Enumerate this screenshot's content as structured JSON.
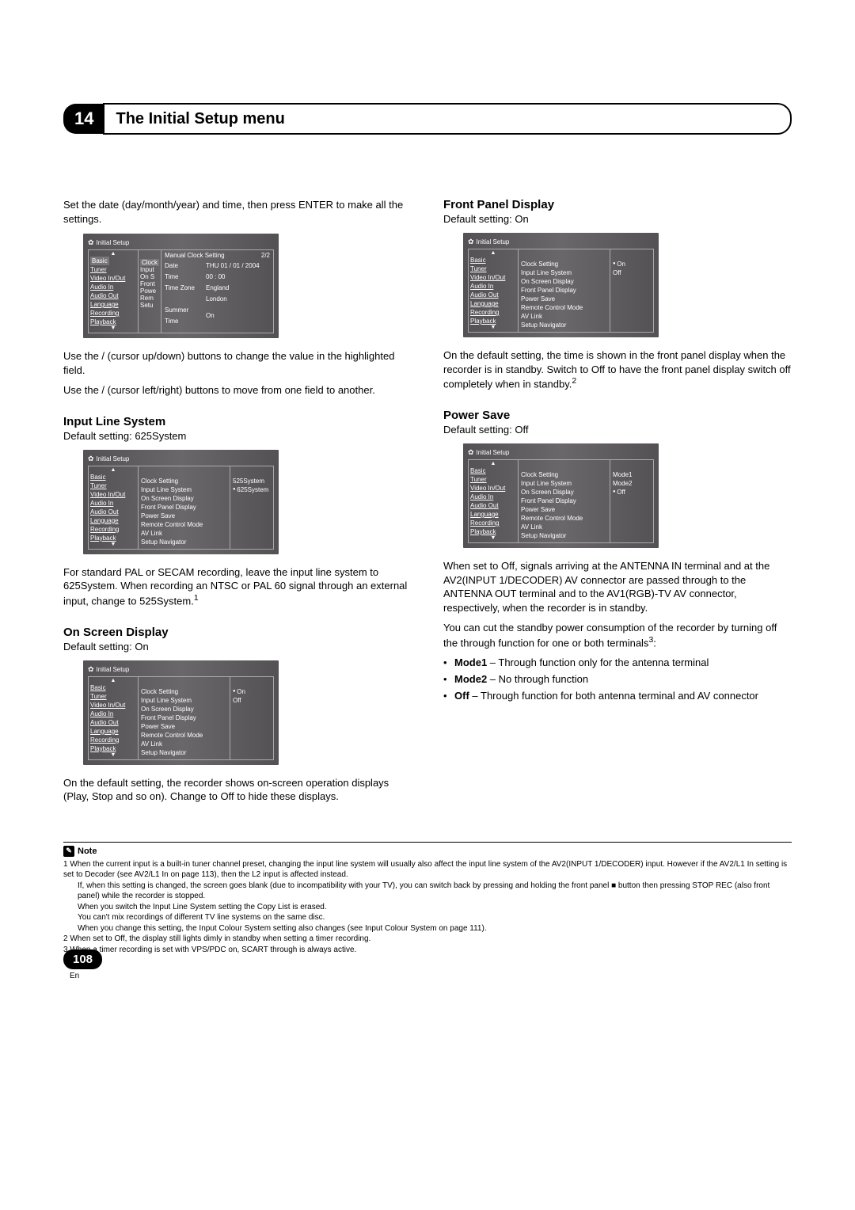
{
  "header": {
    "chapter_num": "14",
    "title": "The Initial Setup menu"
  },
  "col_left": {
    "intro_line1": "Set the date (day/month/year) and time, then press ENTER to make all the settings.",
    "ui1": {
      "title": "Initial Setup",
      "sidebar": [
        "Basic",
        "Tuner",
        "Video In/Out",
        "Audio In",
        "Audio Out",
        "Language",
        "Recording",
        "Playback"
      ],
      "sidebar_highlight_index": 0,
      "middle_hl": "Clock",
      "middle_rest": [
        "Input",
        "On S",
        "Front",
        "Powe",
        "Rem",
        "Setu"
      ],
      "clock_hdr_left": "Manual Clock Setting",
      "clock_hdr_right": "2/2",
      "rows": [
        {
          "label": "Date",
          "value": "THU  01 / 01 / 2004",
          "arrows": true
        },
        {
          "label": "Time",
          "value": "00 : 00"
        },
        {
          "label": "Time Zone",
          "value": "England"
        },
        {
          "label": "",
          "value": "London"
        },
        {
          "label": "Summer Time",
          "value": "On"
        }
      ]
    },
    "p1": "Use the / (cursor up/down) buttons to change the value in the highlighted field.",
    "p2": "Use the / (cursor left/right) buttons to move from one field to another.",
    "sec1_h": "Input Line System",
    "sec1_def": "Default setting: 625System",
    "ui2": {
      "title": "Initial Setup",
      "sidebar": [
        "Basic",
        "Tuner",
        "Video In/Out",
        "Audio In",
        "Audio Out",
        "Language",
        "Recording",
        "Playback"
      ],
      "middle": [
        "Clock Setting",
        "Input Line System",
        "On Screen Display",
        "Front Panel Display",
        "Power Save",
        "Remote Control Mode",
        "AV Link",
        "Setup Navigator"
      ],
      "options": [
        "525System",
        "625System"
      ],
      "selected_index": 1
    },
    "sec1_p1_a": "For standard PAL or SECAM recording, leave the input line system to ",
    "sec1_p1_b": "625System",
    "sec1_p1_c": ". When recording an NTSC or PAL 60 signal through an external input, change to ",
    "sec1_p1_d": "525System",
    "sec1_p1_e": ".",
    "sup1": "1",
    "sec2_h": "On Screen Display",
    "sec2_def": "Default setting: On",
    "ui3": {
      "title": "Initial Setup",
      "sidebar": [
        "Basic",
        "Tuner",
        "Video In/Out",
        "Audio In",
        "Audio Out",
        "Language",
        "Recording",
        "Playback"
      ],
      "middle": [
        "Clock Setting",
        "Input Line System",
        "On Screen Display",
        "Front Panel Display",
        "Power Save",
        "Remote Control Mode",
        "AV Link",
        "Setup Navigator"
      ],
      "options": [
        "On",
        "Off"
      ],
      "selected_index": 0
    },
    "sec2_p": "On the default setting, the recorder shows on-screen operation displays (Play, Stop and so on). Change to Off to hide these displays."
  },
  "col_right": {
    "sec3_h": "Front Panel Display",
    "sec3_def": "Default setting: On",
    "ui4": {
      "title": "Initial Setup",
      "sidebar": [
        "Basic",
        "Tuner",
        "Video In/Out",
        "Audio In",
        "Audio Out",
        "Language",
        "Recording",
        "Playback"
      ],
      "middle": [
        "Clock Setting",
        "Input Line System",
        "On Screen Display",
        "Front Panel Display",
        "Power Save",
        "Remote Control Mode",
        "AV Link",
        "Setup Navigator"
      ],
      "options": [
        "On",
        "Off"
      ],
      "selected_index": 0
    },
    "sec3_p": "On the default setting, the time is shown in the front panel display when the recorder is in standby. Switch to Off to have the front panel display switch off completely when in standby.",
    "sup2": "2",
    "sec4_h": "Power Save",
    "sec4_def": "Default setting: Off",
    "ui5": {
      "title": "Initial Setup",
      "sidebar": [
        "Basic",
        "Tuner",
        "Video In/Out",
        "Audio In",
        "Audio Out",
        "Language",
        "Recording",
        "Playback"
      ],
      "middle": [
        "Clock Setting",
        "Input Line System",
        "On Screen Display",
        "Front Panel Display",
        "Power Save",
        "Remote Control Mode",
        "AV Link",
        "Setup Navigator"
      ],
      "options": [
        "Mode1",
        "Mode2",
        "Off"
      ],
      "selected_index": 2
    },
    "sec4_p1": "When set to Off, signals arriving at the ANTENNA IN terminal and at the AV2(INPUT 1/DECODER) AV connector are passed through to the ANTENNA OUT terminal and to the AV1(RGB)-TV AV connector, respectively, when the recorder is in standby.",
    "sec4_p2a": "You can cut the standby power consumption of the recorder by turning off the through function for one or both terminals",
    "sup3": "3",
    "sec4_p2b": ":",
    "li1_a": "Mode1",
    "li1_b": " – Through function only for the antenna terminal",
    "li2_a": "Mode2",
    "li2_b": " – No through function",
    "li3_a": "Off",
    "li3_b": " – Through function for both antenna terminal and AV connector"
  },
  "notes": {
    "head": "Note",
    "n1": "1  When the current input is a built-in tuner channel preset, changing the input line system will usually also affect the input line system of the AV2(INPUT 1/DECODER) input. However if the AV2/L1 In setting is set to Decoder (see AV2/L1 In on page 113), then the L2 input is affected instead.",
    "n1b": "If, when this setting is changed, the screen goes blank (due to incompatibility with your TV), you can switch back by pressing and holding the front panel ■ button then pressing STOP REC (also front panel) while the recorder is stopped.",
    "n1c": "When you switch the Input Line System setting the Copy List is erased.",
    "n1d": "You can't mix recordings of different TV line systems on the same disc.",
    "n1e": "When you change this setting, the Input Colour System setting also changes (see Input Colour System on page 111).",
    "n2": "2 When set to Off, the display still lights dimly in standby when setting a timer recording.",
    "n3": "3 When a timer recording is set with VPS/PDC on, SCART through is always active."
  },
  "page_num": "108",
  "page_lang": "En"
}
